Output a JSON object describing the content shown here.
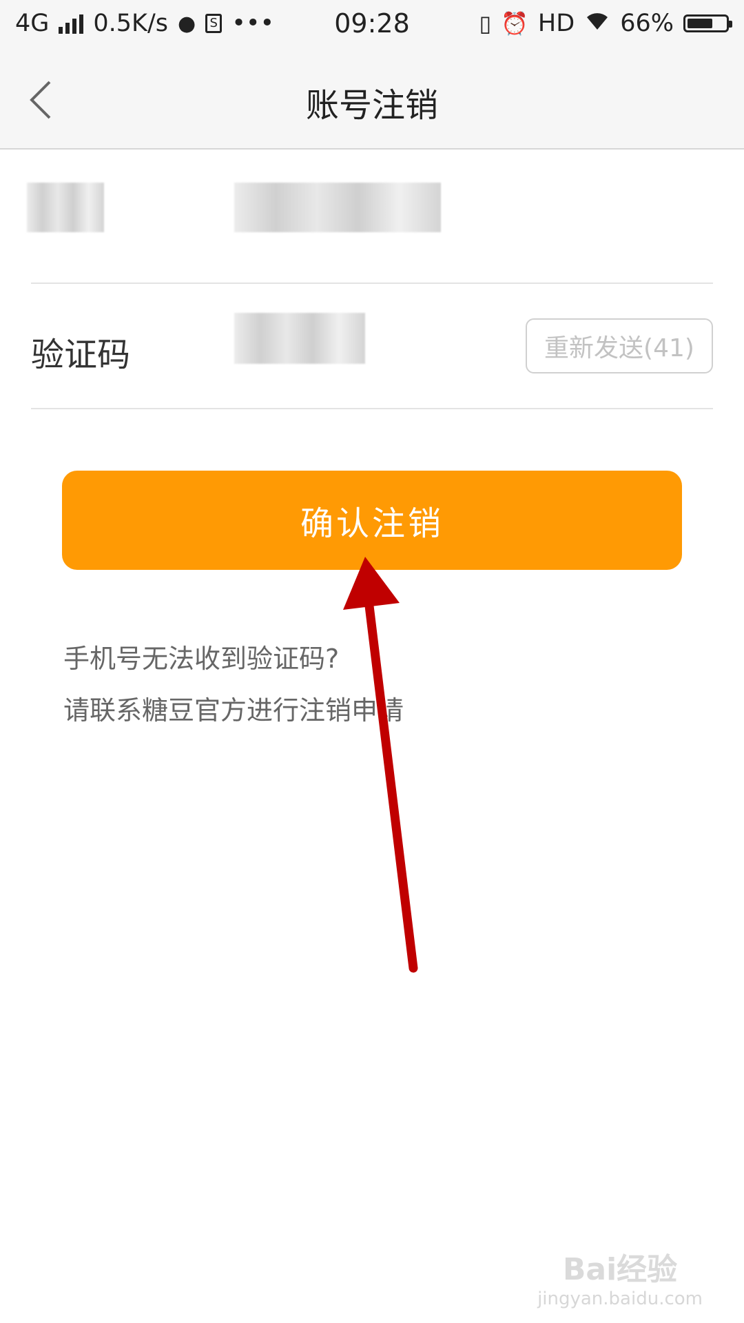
{
  "status_bar": {
    "network": "4G",
    "speed": "0.5K/s",
    "time": "09:28",
    "hd": "HD",
    "battery_percent": "66%",
    "battery_level": 0.66
  },
  "header": {
    "title": "账号注销"
  },
  "form": {
    "code_label": "验证码",
    "resend_label": "重新发送(41)"
  },
  "confirm_button": "确认注销",
  "help": {
    "line1": "手机号无法收到验证码?",
    "line2": "请联系糖豆官方进行注销申请"
  },
  "watermark": {
    "main": "Bai经验",
    "sub": "jingyan.baidu.com"
  },
  "colors": {
    "accent": "#ff9a04",
    "annotation_arrow": "#c00000"
  }
}
